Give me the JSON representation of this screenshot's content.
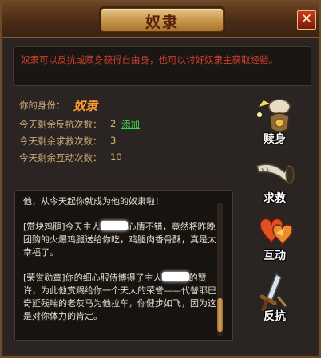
{
  "dialog": {
    "title": "奴隶",
    "close_label": "✕"
  },
  "notice": "奴隶可以反抗或赎身获得自由身，也可以讨好奴隶主获取经验。",
  "status": {
    "identity_label": "你的身份：",
    "identity_value": "奴隶",
    "resist_label": "今天剩余反抗次数：",
    "resist_value": "2",
    "add_label": "添加",
    "rescue_label": "今天剩余求救次数：",
    "rescue_value": "3",
    "interact_label": "今天剩余互动次数：",
    "interact_value": "10"
  },
  "messages": {
    "line1": "他，从今天起你就成为他的奴隶啦！",
    "m2_a": "[赏块鸡腿]今天主人",
    "m2_b": "心情不错，竟然将昨晚团购的火爆鸡腿送给你吃，鸡腿肉香骨酥，真是太幸福了。",
    "m3_a": "[荣誉勋章]你的细心服侍博得了主人",
    "m3_b": "的赞许，为此他赏赐给你一个天大的荣誉——代替耶巴奇延残喘的老灰马为他拉车，你健步如飞，因为这是对你体力的肯定。"
  },
  "actions": {
    "redeem": "赎身",
    "rescue": "求救",
    "interact": "互动",
    "resist": "反抗"
  },
  "colors": {
    "notice_red": "#d0402b",
    "label_gold": "#c9a776",
    "link_green": "#3dd34a",
    "identity_orange": "#ff9a30"
  }
}
